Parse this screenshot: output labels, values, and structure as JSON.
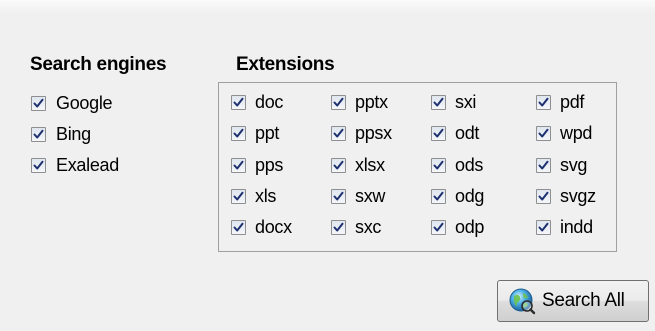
{
  "search_engines": {
    "heading": "Search engines",
    "items": [
      {
        "label": "Google",
        "checked": true
      },
      {
        "label": "Bing",
        "checked": true
      },
      {
        "label": "Exalead",
        "checked": true
      }
    ]
  },
  "extensions": {
    "heading": "Extensions",
    "columns": [
      [
        {
          "label": "doc",
          "checked": true
        },
        {
          "label": "ppt",
          "checked": true
        },
        {
          "label": "pps",
          "checked": true
        },
        {
          "label": "xls",
          "checked": true
        },
        {
          "label": "docx",
          "checked": true
        }
      ],
      [
        {
          "label": "pptx",
          "checked": true
        },
        {
          "label": "ppsx",
          "checked": true
        },
        {
          "label": "xlsx",
          "checked": true
        },
        {
          "label": "sxw",
          "checked": true
        },
        {
          "label": "sxc",
          "checked": true
        }
      ],
      [
        {
          "label": "sxi",
          "checked": true
        },
        {
          "label": "odt",
          "checked": true
        },
        {
          "label": "ods",
          "checked": true
        },
        {
          "label": "odg",
          "checked": true
        },
        {
          "label": "odp",
          "checked": true
        }
      ],
      [
        {
          "label": "pdf",
          "checked": true
        },
        {
          "label": "wpd",
          "checked": true
        },
        {
          "label": "svg",
          "checked": true
        },
        {
          "label": "svgz",
          "checked": true
        },
        {
          "label": "indd",
          "checked": true
        }
      ]
    ]
  },
  "search_button": {
    "label": "Search All",
    "icon": "globe-search-icon"
  },
  "colors": {
    "background": "#f0f0f0",
    "checkmark": "#1c2f6e",
    "box_border": "#a0a0a0"
  }
}
